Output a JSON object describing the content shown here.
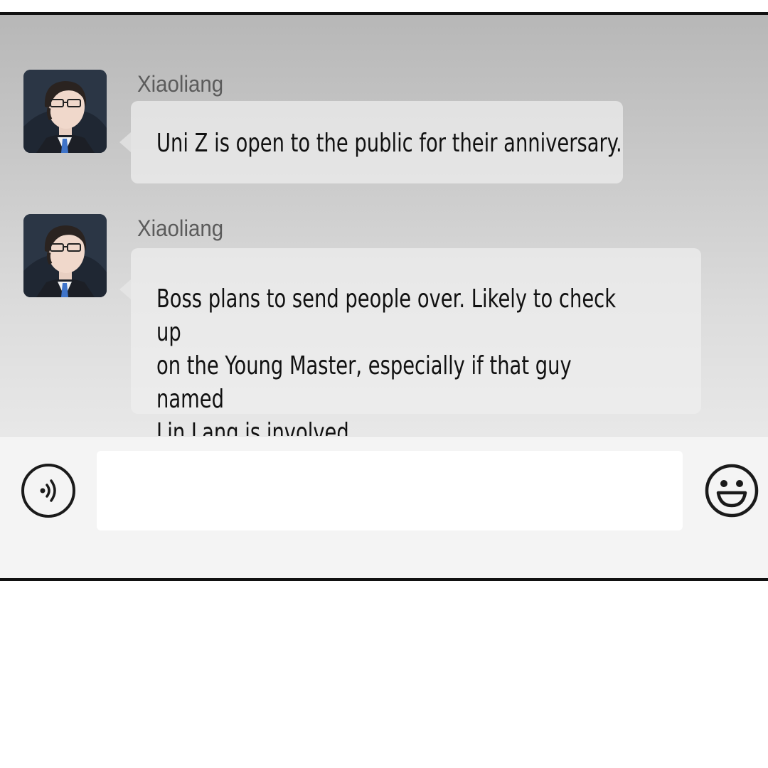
{
  "chat": {
    "messages": [
      {
        "sender": "Xiaoliang",
        "text": "Uni Z is open to the public for their anniversary.",
        "avatar_icon": "avatar-icon"
      },
      {
        "sender": "Xiaoliang",
        "text": "Boss plans to send people over. Likely to check up\non the Young Master, especially if that guy named\nLin Lang is involved.",
        "avatar_icon": "avatar-icon"
      }
    ]
  },
  "input_bar": {
    "voice_icon": "voice-icon",
    "input_value": "",
    "emoji_icon": "smiley-icon"
  },
  "colors": {
    "chat_bg_top": "#b7b7b7",
    "chat_bg_bottom": "#e8e8e8",
    "input_bar_bg": "#f4f4f4",
    "border": "#111111"
  }
}
